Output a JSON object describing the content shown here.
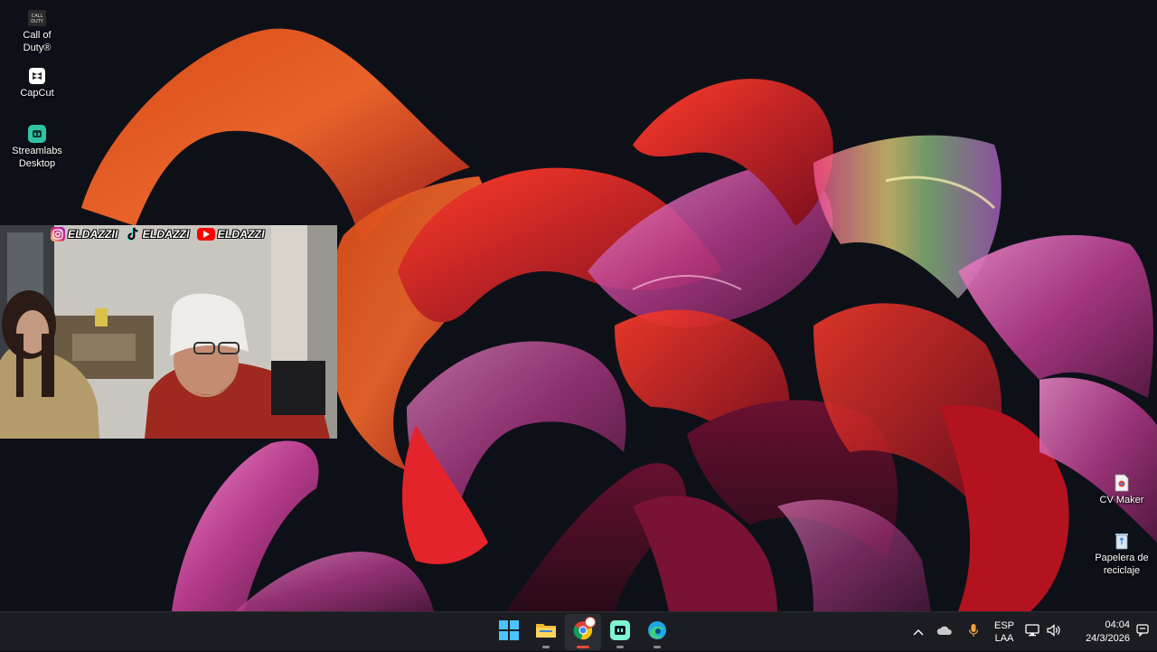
{
  "desktop": {
    "icons": [
      {
        "id": "cod",
        "label": "Call of\nDuty®",
        "icon": "call-of-duty-icon",
        "badge": "CALL\nDUTY"
      },
      {
        "id": "capcut",
        "label": "CapCut",
        "icon": "capcut-icon"
      },
      {
        "id": "streamlabs",
        "label": "Streamlabs\nDesktop",
        "icon": "streamlabs-icon"
      },
      {
        "id": "cvmaker",
        "label": "CV Maker",
        "icon": "cv-maker-file-icon"
      },
      {
        "id": "recycle",
        "label": "Papelera de\nreciclaje",
        "icon": "recycle-bin-icon"
      }
    ]
  },
  "overlay": {
    "socials": [
      {
        "network": "instagram",
        "handle": "ELDAZZII",
        "icon": "instagram-icon",
        "color": "#e1306c"
      },
      {
        "network": "tiktok",
        "handle": "ELDAZZI",
        "icon": "tiktok-icon",
        "color": "#000000"
      },
      {
        "network": "youtube",
        "handle": "ELDAZZI",
        "icon": "youtube-icon",
        "color": "#ff0000"
      }
    ]
  },
  "taskbar": {
    "apps": [
      {
        "name": "start",
        "icon": "windows-start-icon"
      },
      {
        "name": "file-explorer",
        "icon": "folder-icon"
      },
      {
        "name": "chrome",
        "icon": "chrome-icon",
        "active": true
      },
      {
        "name": "streamlabs",
        "icon": "streamlabs-icon"
      },
      {
        "name": "edge",
        "icon": "edge-icon"
      }
    ],
    "tray": {
      "language_top": "ESP",
      "language_bottom": "LAA",
      "time": "04:04",
      "date": "24/3/2026"
    }
  },
  "colors": {
    "taskbar": "#1c1d22",
    "accent": "#e74c3c",
    "wallpaper_bg": "#0b0d14"
  }
}
